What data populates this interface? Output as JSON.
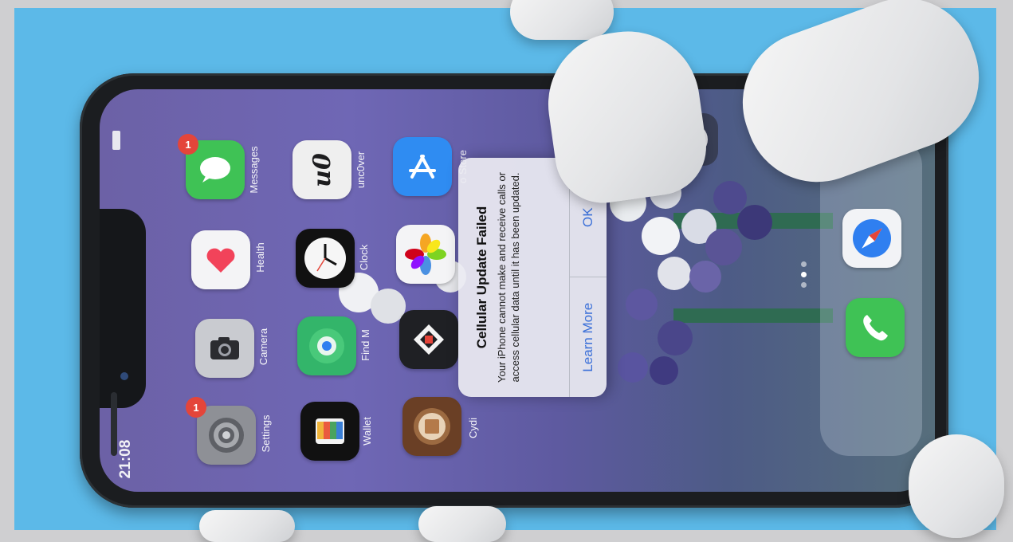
{
  "status_bar": {
    "time": "21:08"
  },
  "apps": [
    {
      "id": "messages",
      "label": "Messages",
      "icon": "messages-icon",
      "badge": "1",
      "color": "#3fc255"
    },
    {
      "id": "health",
      "label": "Health",
      "icon": "heart-icon",
      "badge": "",
      "color": "#f4f4f6"
    },
    {
      "id": "camera",
      "label": "Camera",
      "icon": "camera-icon",
      "badge": "",
      "color": "#c9cbd0"
    },
    {
      "id": "settings",
      "label": "Settings",
      "icon": "gear-icon",
      "badge": "1",
      "color": "#8e9096"
    },
    {
      "id": "unc0ver",
      "label": "unc0ver",
      "icon": "unc0ver-logo-icon",
      "badge": "",
      "color": "#efefef"
    },
    {
      "id": "clock",
      "label": "Clock",
      "icon": "clock-icon",
      "badge": "",
      "color": "#111111"
    },
    {
      "id": "findmy",
      "label": "Find M",
      "icon": "find-my-icon",
      "badge": "",
      "color": "#33b56a"
    },
    {
      "id": "wallet",
      "label": "Wallet",
      "icon": "wallet-icon",
      "badge": "",
      "color": "#111111"
    },
    {
      "id": "appstore",
      "label": "o Store",
      "icon": "app-store-icon",
      "badge": "",
      "color": "#2f8cf2"
    },
    {
      "id": "photos",
      "label": "",
      "icon": "photos-icon",
      "badge": "",
      "color": "#f4f4f6"
    },
    {
      "id": "unknown",
      "label": "",
      "icon": "diamond-app-icon",
      "badge": "",
      "color": "#1f2024"
    },
    {
      "id": "cydia",
      "label": "Cydi",
      "icon": "cydia-icon",
      "badge": "",
      "color": "#6a3f25"
    }
  ],
  "dock": [
    {
      "id": "safari",
      "label": "",
      "icon": "safari-compass-icon",
      "color": "#f2f3f6"
    },
    {
      "id": "phone",
      "label": "",
      "icon": "phone-icon",
      "color": "#3fc255"
    }
  ],
  "alert": {
    "title": "Cellular Update Failed",
    "message": "Your iPhone cannot make and receive calls or access cellular data until it has been updated.",
    "secondary_button": "Learn More",
    "primary_button": "OK"
  },
  "colors": {
    "alert_button": "#3a6fd8",
    "badge": "#e4453a",
    "background": "#5cb9e8"
  }
}
